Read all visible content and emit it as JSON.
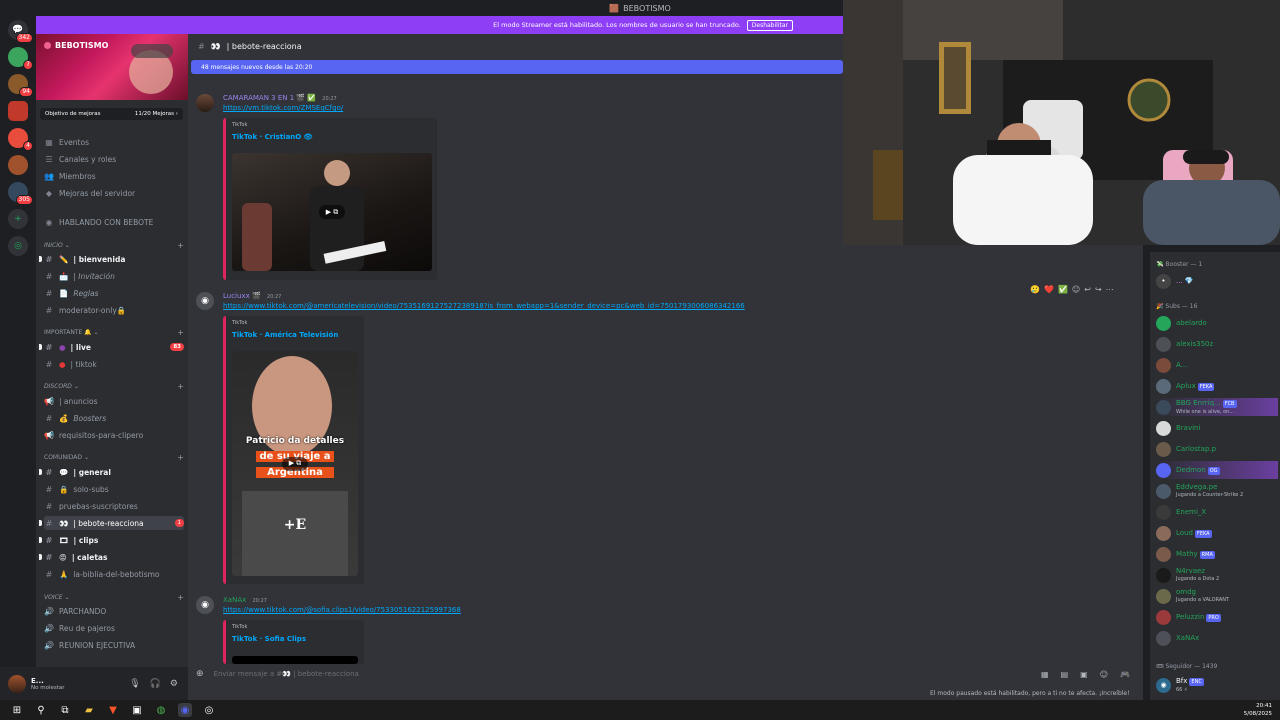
{
  "window": {
    "title": "BEBOTISMO"
  },
  "streamer_banner": {
    "text": "El modo Streamer está habilitado. Los nombres de usuario se han truncado.",
    "button": "Deshabilitar"
  },
  "rail": {
    "servers": [
      {
        "badge": "342",
        "color": "#5865f2",
        "glyph": "◉"
      },
      {
        "badge": "7",
        "color": "#3ba55d",
        "glyph": "●"
      },
      {
        "badge": "94",
        "color": "#8b5a2b",
        "glyph": "●"
      },
      {
        "badge": "",
        "color": "#c0392b",
        "glyph": "■"
      },
      {
        "badge": "4",
        "color": "#e74c3c",
        "glyph": "●"
      },
      {
        "badge": "",
        "color": "#a0522d",
        "glyph": "●"
      },
      {
        "badge": "305",
        "color": "#34495e",
        "glyph": "●"
      }
    ]
  },
  "sidebar": {
    "server_name": "BEBOTISMO",
    "boost_left": "Objetivo de mejoras",
    "boost_right": "11/20 Mejoras ›",
    "top_items": [
      "Eventos",
      "Canales y roles",
      "Miembros",
      "Mejoras del servidor"
    ],
    "hablando": "HABLANDO CON BEBOTE",
    "cat_inicio": "INICIO",
    "cat_importante": "IMPORTANTE 🔔",
    "cat_discord": "DISCORD",
    "cat_comunidad": "COMUNIDAD",
    "cat_voice": "VOICE",
    "channels": {
      "bienvenida": "| bienvenida",
      "invitacion": "| Invitación",
      "reglas": "Reglas",
      "moderator": "moderator-only🔒",
      "live": "| live",
      "live_badge": "83",
      "tiktok": "| tiktok",
      "anuncios": "| anuncios",
      "boosters": "Boosters",
      "requisitos": "requisitos-para-clipero",
      "general": "| general",
      "solo_subs": "solo-subs",
      "pruebas": "pruebas-suscriptores",
      "reacciona": "| bebote-reacciona",
      "reacciona_badge": "1",
      "clips": "| clips",
      "caletas": "| caletas",
      "biblia": "la-biblia-del-bebotismo",
      "parchando": "PARCHANDO",
      "pajeros": "Reu de pajeros",
      "reunion": "REUNION EJECUTIVA"
    }
  },
  "user": {
    "name": "E...",
    "status": "No molestar"
  },
  "chat": {
    "channel": "| bebote-reacciona",
    "new_messages": "48 mensajes nuevos desde las 20:20",
    "messages": [
      {
        "author": "CAMARAMAN 3 EN 1 🎬 ✅",
        "time": "20:27",
        "link": "https://vm.tiktok.com/ZMSEqCfgo/",
        "provider": "TikTok",
        "title": "TikTok · CristianO 👁"
      },
      {
        "author": "Luciuxx 🎬",
        "time": "20:27",
        "link": "https://www.tiktok.com/@americatelevision/video/7535169127527238918?is_from_webapp=1&sender_device=pc&web_id=7501793006086342166",
        "provider": "TikTok",
        "title": "TikTok · América Televisión",
        "caption1": "Patricio da detalles",
        "caption2": "de su viaje a",
        "caption3": "Argentina",
        "logo": "+E"
      },
      {
        "author": "XaNAx",
        "time": "20:27",
        "link": "https://www.tiktok.com/@sofia.clips1/video/7533051622125997368",
        "provider": "TikTok",
        "title": "TikTok · Sofia Clips"
      }
    ],
    "input_placeholder": "Enviar mensaje a #👀 | bebote-reacciona",
    "pause_note": "El modo pausado está habilitado, pero a ti no te afecta. ¡Increíble!"
  },
  "members": {
    "booster_header": "Booster — 1",
    "subs_header": "Subs — 16",
    "seguidor_header": "Seguidor — 1439",
    "list": [
      {
        "name": "abelardo",
        "sub": "",
        "tag": ""
      },
      {
        "name": "alexis350z",
        "sub": "",
        "tag": ""
      },
      {
        "name": "A...",
        "sub": "",
        "tag": ""
      },
      {
        "name": "Aplux",
        "sub": "",
        "tag": "FEKA"
      },
      {
        "name": "BBG Enrriq...",
        "sub": "While one is alive, on...",
        "tag": "FCB"
      },
      {
        "name": "Bravini",
        "sub": "",
        "tag": ""
      },
      {
        "name": "Carlostap.p",
        "sub": "",
        "tag": ""
      },
      {
        "name": "Dedmon",
        "sub": "",
        "tag": "OG"
      },
      {
        "name": "Eddvega.pe",
        "sub": "Jugando a Counter-Strike 2",
        "tag": ""
      },
      {
        "name": "Enemi_X",
        "sub": "",
        "tag": ""
      },
      {
        "name": "Loud",
        "sub": "",
        "tag": "FEKA"
      },
      {
        "name": "Mathy",
        "sub": "",
        "tag": "RMA"
      },
      {
        "name": "N4rvaez",
        "sub": "Jugando a Dota 2",
        "tag": ""
      },
      {
        "name": "omdg",
        "sub": "Jugando a VALORANT",
        "tag": ""
      },
      {
        "name": "Peluzzin",
        "sub": "",
        "tag": "PRO"
      },
      {
        "name": "XaNAx",
        "sub": "",
        "tag": ""
      }
    ],
    "seguidor_first": {
      "name": "Bfx",
      "sub": "66 ⚡",
      "tag": "ENC"
    }
  },
  "clock": {
    "time": "20:41",
    "date": "5/08/2025"
  }
}
